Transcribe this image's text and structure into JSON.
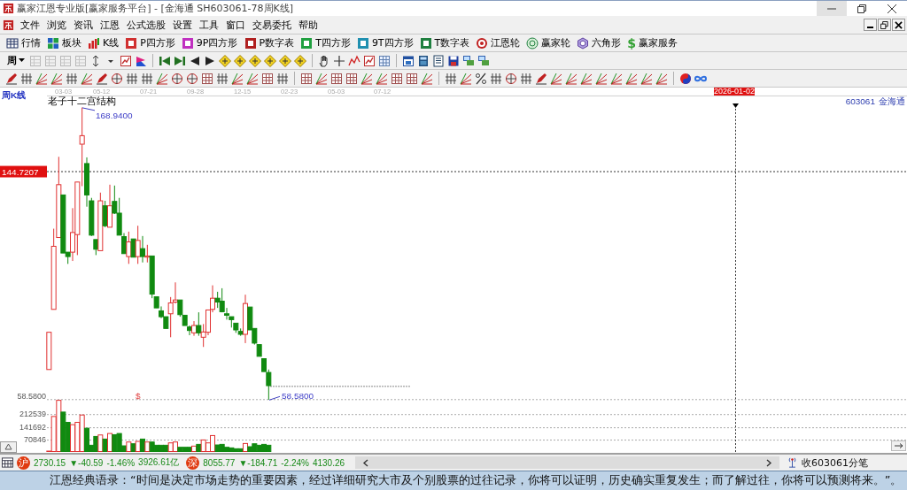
{
  "title_bar": {
    "title": "赢家江恩专业版[赢家服务平台] - [金海通  SH603061-78周K线]"
  },
  "menu": [
    "文件",
    "浏览",
    "资讯",
    "江恩",
    "公式选股",
    "设置",
    "工具",
    "窗口",
    "交易委托",
    "帮助"
  ],
  "toolbar": [
    {
      "label": "行情",
      "kind": "table"
    },
    {
      "label": "板块",
      "kind": "blocks"
    },
    {
      "label": "K线",
      "kind": "candles"
    },
    {
      "label": "P四方形",
      "kind": "box",
      "color": "#d03030"
    },
    {
      "label": "9P四方形",
      "kind": "box",
      "color": "#c030c0"
    },
    {
      "label": "P数字表",
      "kind": "box",
      "color": "#b02020"
    },
    {
      "label": "T四方形",
      "kind": "box",
      "color": "#20a040"
    },
    {
      "label": "9T四方形",
      "kind": "box",
      "color": "#2090b0"
    },
    {
      "label": "T数字表",
      "kind": "box",
      "color": "#208040"
    },
    {
      "label": "江恩轮",
      "kind": "target"
    },
    {
      "label": "赢家轮",
      "kind": "wheel"
    },
    {
      "label": "六角形",
      "kind": "hexagon"
    },
    {
      "label": "赢家服务",
      "kind": "glyph",
      "glyph": "$"
    }
  ],
  "period_selector": {
    "value": "周"
  },
  "chart": {
    "period_label": "周K线",
    "title": "老子十二宫结构",
    "dates": [
      "03-03",
      "05-12",
      "07-21",
      "09-28",
      "12-15",
      "02-23",
      "05-03",
      "07-12"
    ],
    "cursor_date": "2026-01-02",
    "stock_code": "603061",
    "stock_name": "金海通",
    "cursor_price": "144.7207",
    "high_label": "168.9400",
    "low_label": "58.5800",
    "axis_low": "58.5800",
    "marker": "$",
    "volume_ticks": [
      "212539",
      "141692",
      "70846"
    ]
  },
  "status_bar": {
    "indices": [
      {
        "badge": "沪",
        "price": "2730.15",
        "change": "▼-40.59",
        "percent": "-1.46%",
        "amount": "3926.61亿"
      },
      {
        "badge": "深",
        "price": "8055.77",
        "change": "▼-184.71",
        "percent": "-2.24%",
        "amount": "4130.26"
      }
    ],
    "ticker": "收603061分笔"
  },
  "quote_line": "江恩经典语录：“时间是决定市场走势的重要因素，经过详细研究大市及个别股票的过往记录，你将可以证明，历史确实重复发生；而了解过往，你将可以预测将来。”。"
}
